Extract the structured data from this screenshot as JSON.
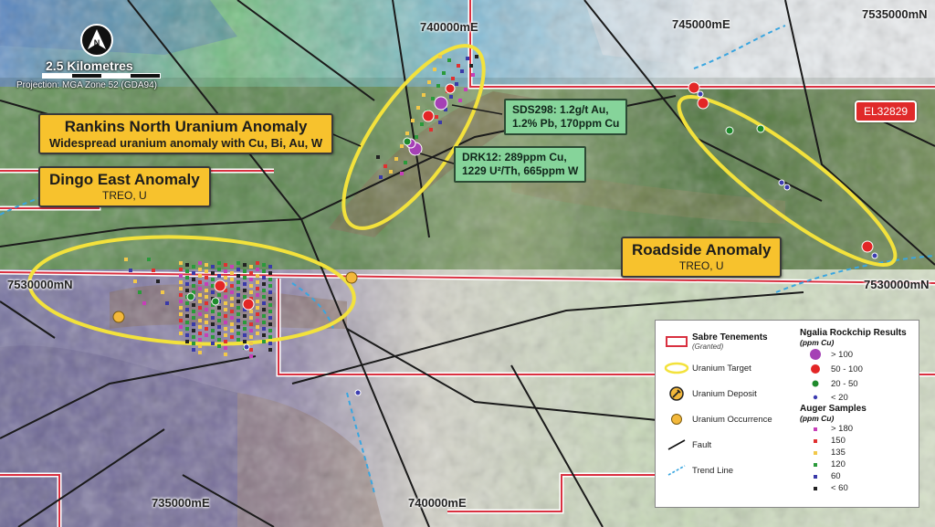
{
  "grid_labels": {
    "e_740_top": "740000mE",
    "e_745_top": "745000mE",
    "n_7535": "7535000mN",
    "n_7530_left": "7530000mN",
    "n_7530_right": "7530000mN",
    "e_735_bottom": "735000mE",
    "e_740_bottom": "740000mE"
  },
  "north_arrow": {
    "letter": "N"
  },
  "scale": {
    "label": "2.5 Kilometres",
    "projection": "Projection: MGA Zone 52 (GDA94)"
  },
  "tenement_tag": "EL32829",
  "anomalies": {
    "rankins": {
      "title": "Rankins North Uranium Anomaly",
      "subtitle": "Widespread uranium anomaly with Cu, Bi, Au, W"
    },
    "dingo": {
      "title": "Dingo East Anomaly",
      "subtitle": "TREO, U"
    },
    "roadside": {
      "title": "Roadside Anomaly",
      "subtitle": "TREO, U"
    }
  },
  "results": {
    "sds298": {
      "line1": "SDS298: 1.2g/t Au,",
      "line2": "1.2% Pb, 170ppm Cu"
    },
    "drk12": {
      "line1": "DRK12: 289ppm Cu,",
      "line2": "1229 U²/Th, 665ppm W"
    }
  },
  "legend": {
    "tenements": "Sabre Tenements",
    "tenements_note": "(Granted)",
    "uranium_target": "Uranium Target",
    "uranium_deposit": "Uranium Deposit",
    "uranium_occurrence": "Uranium Occurrence",
    "fault": "Fault",
    "trend_line": "Trend Line",
    "rockchip_title": "Ngalia Rockchip Results",
    "rockchip_unit": "(ppm Cu)",
    "rockchip_classes": [
      "> 100",
      "50 - 100",
      "20 - 50",
      "< 20"
    ],
    "auger_title": "Auger Samples",
    "auger_unit": "(ppm Cu)",
    "auger_classes": [
      "> 180",
      "150",
      "135",
      "120",
      "60",
      "< 60"
    ]
  },
  "colors": {
    "rock_gt100": "#a540b5",
    "rock_50_100": "#e32626",
    "rock_20_50": "#1f8a2c",
    "rock_lt20": "#3c3cb0",
    "auger_gt180": "#c63fb8",
    "auger_150": "#e03030",
    "auger_135": "#f2c84a",
    "auger_120": "#2a9a3a",
    "auger_60": "#3a3aa8",
    "auger_lt60": "#222222",
    "tenement": "#d93040",
    "target": "#f3e23c",
    "occurrence": "#f3b83a",
    "trend": "#3aa6e0"
  }
}
